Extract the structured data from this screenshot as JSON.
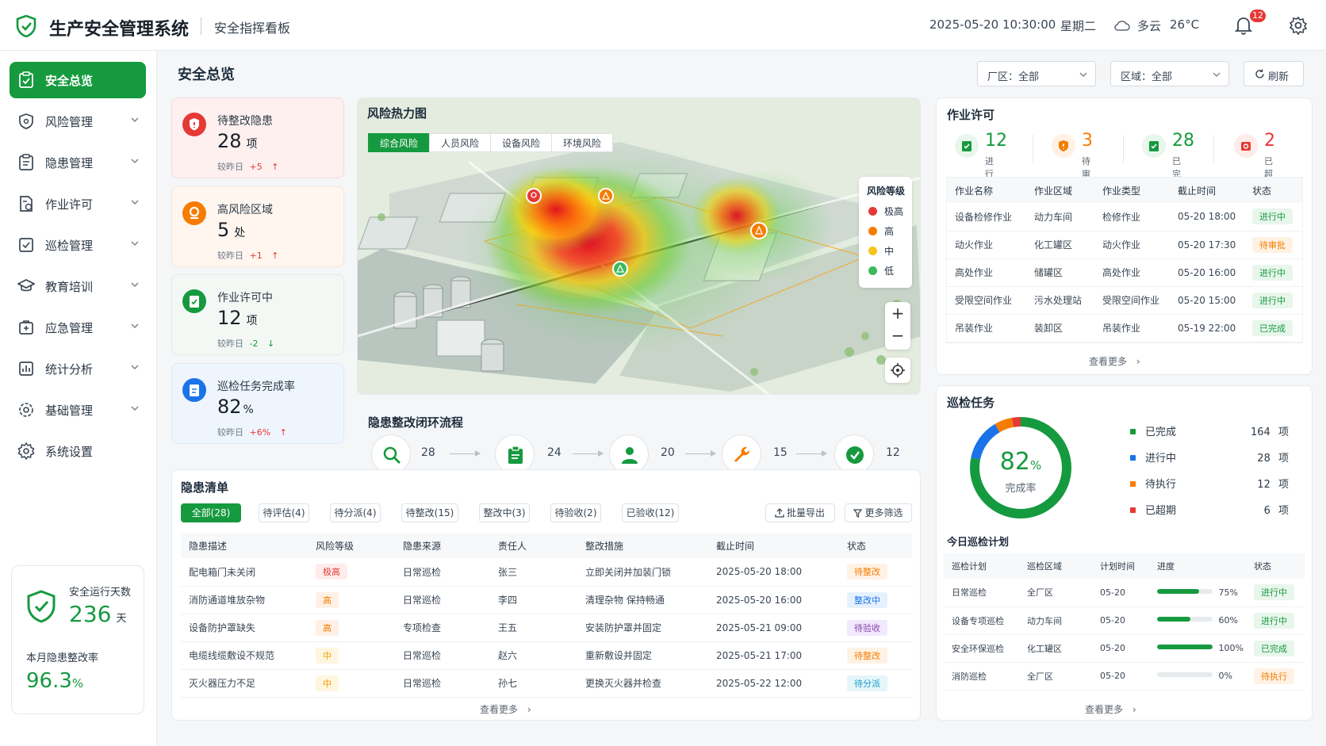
{
  "header": {
    "system_name": "生产安全管理系统",
    "board_name": "安全指挥看板",
    "datetime": "2025-05-20 10:30:00",
    "weekday": "星期二",
    "weather": "多云",
    "temperature": "26°C",
    "notification_count": "12"
  },
  "sidebar": {
    "items": [
      {
        "label": "安全总览",
        "icon": "clipboard-check-icon",
        "active": true
      },
      {
        "label": "风险管理",
        "icon": "shield-icon"
      },
      {
        "label": "隐患管理",
        "icon": "clipboard-icon"
      },
      {
        "label": "作业许可",
        "icon": "permit-doc-icon"
      },
      {
        "label": "巡检管理",
        "icon": "checklist-icon"
      },
      {
        "label": "教育培训",
        "icon": "graduation-cap-icon"
      },
      {
        "label": "应急管理",
        "icon": "first-aid-icon"
      },
      {
        "label": "统计分析",
        "icon": "bar-chart-icon"
      },
      {
        "label": "基础管理",
        "icon": "settings-icon"
      },
      {
        "label": "系统设置",
        "icon": "gear-icon"
      }
    ],
    "safe_days_label": "安全运行天数",
    "safe_days_value": "236",
    "safe_days_unit": "天",
    "rectify_rate_label": "本月隐患整改率",
    "rectify_rate_value": "96.3",
    "rectify_rate_unit": "%"
  },
  "page": {
    "title": "安全总览",
    "factory_filter": "厂区：全部",
    "area_filter": "区域：全部",
    "refresh_label": "刷新"
  },
  "kpis": [
    {
      "label": "待整改隐患",
      "value": "28",
      "unit": "项",
      "compare_label": "较昨日",
      "delta": "+5",
      "trend": "↑",
      "color": "#e53935"
    },
    {
      "label": "高风险区域",
      "value": "5",
      "unit": "处",
      "compare_label": "较昨日",
      "delta": "+1",
      "trend": "↑",
      "color": "#f57c00"
    },
    {
      "label": "作业许可中",
      "value": "12",
      "unit": "项",
      "compare_label": "较昨日",
      "delta": "-2",
      "trend": "↓",
      "color": "#169a3f"
    },
    {
      "label": "巡检任务完成率",
      "value": "82",
      "unit": "%",
      "compare_label": "较昨日",
      "delta": "+6%",
      "trend": "↑",
      "color": "#1a73e8"
    }
  ],
  "heatmap": {
    "title": "风险热力图",
    "tabs": [
      "综合风险",
      "人员风险",
      "设备风险",
      "环境风险"
    ],
    "legend_title": "风险等级",
    "legend": [
      {
        "label": "极高",
        "color": "#e53935"
      },
      {
        "label": "高",
        "color": "#f57c00"
      },
      {
        "label": "中",
        "color": "#f5c518"
      },
      {
        "label": "低",
        "color": "#3dbb5b"
      }
    ],
    "zoom_in": "+",
    "zoom_out": "−"
  },
  "flow": {
    "title": "隐患整改闭环流程",
    "steps": [
      {
        "label": "发现",
        "count": "28"
      },
      {
        "label": "评估",
        "count": "24"
      },
      {
        "label": "分派",
        "count": "20"
      },
      {
        "label": "整改",
        "count": "15"
      },
      {
        "label": "验收",
        "count": "12"
      }
    ]
  },
  "hazards": {
    "title": "隐患清单",
    "filters": [
      "全部(28)",
      "待评估(4)",
      "待分派(4)",
      "待整改(15)",
      "整改中(3)",
      "待验收(2)",
      "已验收(12)"
    ],
    "export_label": "批量导出",
    "more_filter_label": "更多筛选",
    "columns": [
      "隐患描述",
      "风险等级",
      "隐患来源",
      "责任人",
      "整改措施",
      "截止时间",
      "状态"
    ],
    "rows": [
      {
        "desc": "配电箱门未关闭",
        "level": "极高",
        "source": "日常巡检",
        "owner": "张三",
        "measure": "立即关闭并加装门锁",
        "deadline": "2025-05-20 18:00",
        "status": "待整改"
      },
      {
        "desc": "消防通道堆放杂物",
        "level": "高",
        "source": "日常巡检",
        "owner": "李四",
        "measure": "清理杂物 保持畅通",
        "deadline": "2025-05-20 16:00",
        "status": "整改中"
      },
      {
        "desc": "设备防护罩缺失",
        "level": "高",
        "source": "专项检查",
        "owner": "王五",
        "measure": "安装防护罩并固定",
        "deadline": "2025-05-21 09:00",
        "status": "待验收"
      },
      {
        "desc": "电缆线缆敷设不规范",
        "level": "中",
        "source": "日常巡检",
        "owner": "赵六",
        "measure": "重新敷设并固定",
        "deadline": "2025-05-21 17:00",
        "status": "待整改"
      },
      {
        "desc": "灭火器压力不足",
        "level": "中",
        "source": "日常巡检",
        "owner": "孙七",
        "measure": "更换灭火器并检查",
        "deadline": "2025-05-22 12:00",
        "status": "待分派"
      }
    ],
    "more_label": "查看更多"
  },
  "permits": {
    "title": "作业许可",
    "stats": [
      {
        "value": "12",
        "label": "进行中",
        "color": "#169a3f"
      },
      {
        "value": "3",
        "label": "待审批",
        "color": "#f57c00"
      },
      {
        "value": "28",
        "label": "已完成",
        "color": "#169a3f"
      },
      {
        "value": "2",
        "label": "已超期",
        "color": "#e53935"
      }
    ],
    "columns": [
      "作业名称",
      "作业区域",
      "作业类型",
      "截止时间",
      "状态"
    ],
    "rows": [
      {
        "name": "设备检修作业",
        "area": "动力车间",
        "type": "检修作业",
        "deadline": "05-20 18:00",
        "status": "进行中"
      },
      {
        "name": "动火作业",
        "area": "化工罐区",
        "type": "动火作业",
        "deadline": "05-20 17:30",
        "status": "待审批"
      },
      {
        "name": "高处作业",
        "area": "储罐区",
        "type": "高处作业",
        "deadline": "05-20 16:00",
        "status": "进行中"
      },
      {
        "name": "受限空间作业",
        "area": "污水处理站",
        "type": "受限空间作业",
        "deadline": "05-20 15:00",
        "status": "进行中"
      },
      {
        "name": "吊装作业",
        "area": "装卸区",
        "type": "吊装作业",
        "deadline": "05-19 22:00",
        "status": "已完成"
      }
    ],
    "more_label": "查看更多"
  },
  "patrol": {
    "title": "巡检任务",
    "rate_value": "82",
    "rate_unit": "%",
    "rate_label": "完成率",
    "legend": [
      {
        "label": "已完成",
        "count": "164",
        "unit": "项",
        "color": "#169a3f"
      },
      {
        "label": "进行中",
        "count": "28",
        "unit": "项",
        "color": "#1a73e8"
      },
      {
        "label": "待执行",
        "count": "12",
        "unit": "项",
        "color": "#f57c00"
      },
      {
        "label": "已超期",
        "count": "6",
        "unit": "项",
        "color": "#e53935"
      }
    ],
    "plan_title": "今日巡检计划",
    "columns": [
      "巡检计划",
      "巡检区域",
      "计划时间",
      "进度",
      "状态"
    ],
    "rows": [
      {
        "plan": "日常巡检",
        "area": "全厂区",
        "time": "05-20",
        "progress": 75,
        "progress_label": "75%",
        "status": "进行中"
      },
      {
        "plan": "设备专项巡检",
        "area": "动力车间",
        "time": "05-20",
        "progress": 60,
        "progress_label": "60%",
        "status": "进行中"
      },
      {
        "plan": "安全环保巡检",
        "area": "化工罐区",
        "time": "05-20",
        "progress": 100,
        "progress_label": "100%",
        "status": "已完成"
      },
      {
        "plan": "消防巡检",
        "area": "全厂区",
        "time": "05-20",
        "progress": 0,
        "progress_label": "0%",
        "status": "待执行"
      }
    ],
    "more_label": "查看更多"
  }
}
